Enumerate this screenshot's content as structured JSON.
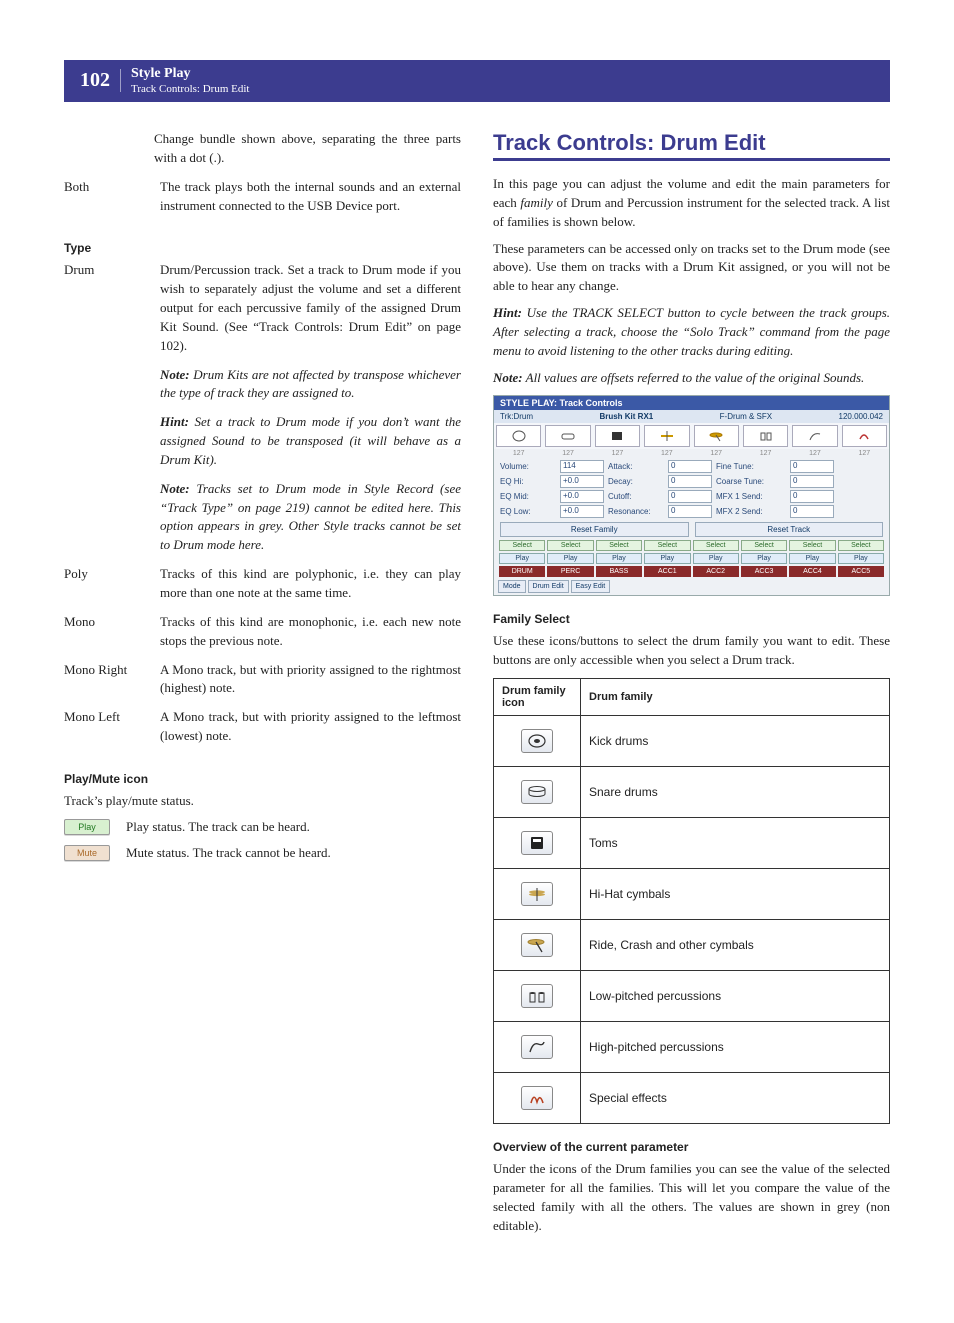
{
  "header": {
    "page_number": "102",
    "title": "Style Play",
    "subtitle": "Track Controls: Drum Edit"
  },
  "left": {
    "intro_continuation": "Change bundle shown above, separating the three parts with a dot (.).",
    "both_term": "Both",
    "both_desc": "The track plays both the internal sounds and an external instrument connected to the USB Device port.",
    "type_heading": "Type",
    "drum_term": "Drum",
    "drum_desc": "Drum/Percussion track. Set a track to Drum mode if you wish to separately adjust the volume and set a different output for each percussive family of the assigned Drum Kit Sound. (See “Track Controls: Drum Edit” on page 102).",
    "drum_note1_label": "Note:",
    "drum_note1": "Drum Kits are not affected by transpose whichever the type of track they are assigned to.",
    "drum_hint_label": "Hint:",
    "drum_hint": "Set a track to Drum mode if you don’t want the assigned Sound to be transposed (it will behave as a Drum Kit).",
    "drum_note2_label": "Note:",
    "drum_note2": "Tracks set to Drum mode in Style Record (see “Track Type” on page 219) cannot be edited here. This option appears in grey. Other Style tracks cannot be set to Drum mode here.",
    "poly_term": "Poly",
    "poly_desc": "Tracks of this kind are polyphonic, i.e. they can play more than one note at the same time.",
    "mono_term": "Mono",
    "mono_desc": "Tracks of this kind are monophonic, i.e. each new note stops the previous note.",
    "mono_right_term": "Mono Right",
    "mono_right_desc": "A Mono track, but with priority assigned to the rightmost (highest) note.",
    "mono_left_term": "Mono Left",
    "mono_left_desc": "A Mono track, but with priority assigned to the leftmost (lowest) note.",
    "pm_heading": "Play/Mute icon",
    "pm_intro": "Track’s play/mute status.",
    "play_label": "Play",
    "play_desc": "Play status. The track can be heard.",
    "mute_label": "Mute",
    "mute_desc": "Mute status. The track cannot be heard."
  },
  "right": {
    "h2": "Track Controls: Drum Edit",
    "p1": "In this page you can adjust the volume and edit the main parameters for each family of Drum and Percussion instrument for the selected track. A list of families is shown below.",
    "p2": "These parameters can be accessed only on tracks set to the Drum mode (see above). Use them on tracks with a Drum Kit assigned, or you will not be able to hear any change.",
    "hint_label": "Hint:",
    "hint_text": "Use the TRACK SELECT button to cycle between the track groups. After selecting a track, choose the “Solo Track” command from the page menu to avoid listening to the other tracks during editing.",
    "note_label": "Note:",
    "note_text": "All values are offsets referred to the value of the original Sounds.",
    "family_select_heading": "Family Select",
    "family_select_text": "Use these icons/buttons to select the drum family you want to edit. These buttons are only accessible when you select a Drum track.",
    "table_header_icon": "Drum family icon",
    "table_header_name": "Drum family",
    "families": [
      "Kick drums",
      "Snare drums",
      "Toms",
      "Hi-Hat cymbals",
      "Ride, Crash and other cymbals",
      "Low-pitched percussions",
      "High-pitched percussions",
      "Special effects"
    ],
    "overview_heading": "Overview of the current parameter",
    "overview_text": "Under the icons of the Drum families you can see the value of the selected parameter for all the families. This will let you compare the value of the selected family with all the others. The values are shown in grey (non editable)."
  },
  "screenshot": {
    "titlebar": "STYLE PLAY: Track Controls",
    "trk": "Trk:Drum",
    "kit": "Brush Kit RX1",
    "chan": "F-Drum & SFX",
    "num": "120.000.042",
    "icon_values": [
      "127",
      "127",
      "127",
      "127",
      "127",
      "127",
      "127",
      "127"
    ],
    "params": [
      [
        "Volume:",
        "114",
        "Attack:",
        "0",
        "Fine Tune:",
        "0"
      ],
      [
        "EQ Hi:",
        "+0.0",
        "Decay:",
        "0",
        "Coarse Tune:",
        "0"
      ],
      [
        "EQ Mid:",
        "+0.0",
        "Cutoff:",
        "0",
        "MFX 1 Send:",
        "0"
      ],
      [
        "EQ Low:",
        "+0.0",
        "Resonance:",
        "0",
        "MFX 2 Send:",
        "0"
      ]
    ],
    "reset_family": "Reset Family",
    "reset_track": "Reset Track",
    "select_label": "Select",
    "play_label": "Play",
    "tracks": [
      "DRUM",
      "PERC",
      "BASS",
      "ACC1",
      "ACC2",
      "ACC3",
      "ACC4",
      "ACC5"
    ],
    "bottom": [
      "Mode",
      "Drum Edit",
      "Easy Edit"
    ]
  }
}
